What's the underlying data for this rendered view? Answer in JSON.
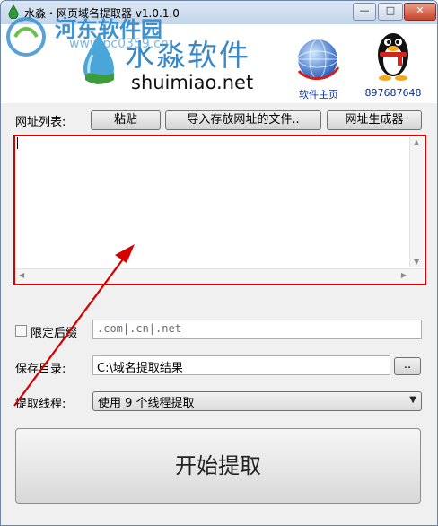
{
  "window": {
    "title": "水淼・网页域名提取器 v1.0.1.0",
    "min_glyph": "—",
    "max_glyph": "□",
    "close_glyph": "✕"
  },
  "watermark": {
    "title": "河东软件园",
    "url": "www.pc0359.cn"
  },
  "banner": {
    "brand_cn": "水淼软件",
    "brand_en": "shuimiao.net",
    "home_label": "软件主页",
    "qq_label": "897687648"
  },
  "url_list": {
    "label": "网址列表:",
    "paste_button": "粘贴",
    "import_button": "导入存放网址的文件..",
    "generator_button": "网址生成器",
    "content": ""
  },
  "suffix": {
    "checkbox_label": "限定后缀",
    "checked": false,
    "value": ".com|.cn|.net"
  },
  "save_dir": {
    "label": "保存目录:",
    "value": "C:\\域名提取结果",
    "browse_button": ".."
  },
  "threads": {
    "label": "提取线程:",
    "selected": "使用 9 个线程提取"
  },
  "start_button": "开始提取",
  "colors": {
    "highlight": "#d40000",
    "brand": "#3a87c6",
    "link": "#0a2c8c"
  }
}
